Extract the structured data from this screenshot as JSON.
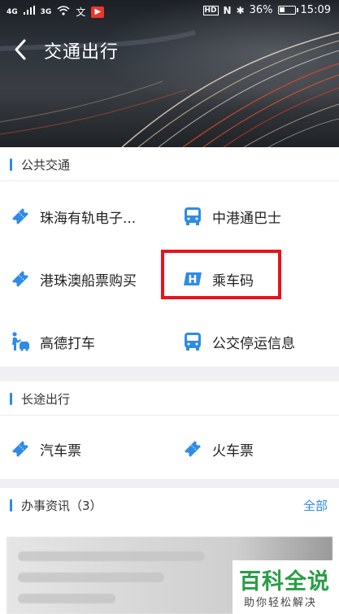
{
  "status_bar": {
    "signal_1": "4G",
    "signal_2": "3G",
    "hd": "HD",
    "nfc": "N",
    "battery": "36%",
    "battery_level": 0.36,
    "time": "15:09"
  },
  "header": {
    "title": "交通出行"
  },
  "public_transit": {
    "title": "公共交通",
    "items": [
      {
        "label": "珠海有轨电子...",
        "icon": "ticket-icon"
      },
      {
        "label": "中港通巴士",
        "icon": "bus-icon"
      },
      {
        "label": "港珠澳船票购买",
        "icon": "ticket-icon"
      },
      {
        "label": "乘车码",
        "icon": "h-card-icon"
      },
      {
        "label": "高德打车",
        "icon": "taxi-person-icon"
      },
      {
        "label": "公交停运信息",
        "icon": "bus-icon"
      }
    ]
  },
  "long_distance": {
    "title": "长途出行",
    "items": [
      {
        "label": "汽车票",
        "icon": "ticket-icon"
      },
      {
        "label": "火车票",
        "icon": "ticket-icon"
      }
    ]
  },
  "news": {
    "title": "办事资讯（3）",
    "more": "全部"
  },
  "watermark": {
    "main": "百科全说",
    "sub": "助你轻松解决"
  },
  "colors": {
    "accent": "#2f8be6",
    "highlight": "#e8121d",
    "watermark_green": "#2a9d46"
  }
}
